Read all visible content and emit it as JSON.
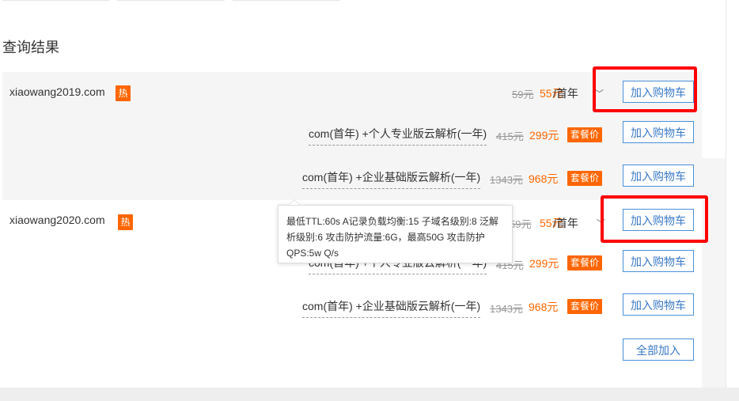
{
  "section_title": "查询结果",
  "domains": [
    {
      "name": "xiaowang2019.com",
      "hot_badge": "热",
      "old_price": "59元",
      "new_price": "55元",
      "unit": "/首年",
      "add_cart": "加入购物车",
      "bundles": [
        {
          "label": "com(首年) +个人专业版云解析(一年)",
          "old_price": "415元",
          "new_price": "299元",
          "deal": "套餐价",
          "add_cart": "加入购物车"
        },
        {
          "label": "com(首年) +企业基础版云解析(一年)",
          "old_price": "1343元",
          "new_price": "968元",
          "deal": "套餐价",
          "add_cart": "加入购物车"
        }
      ]
    },
    {
      "name": "xiaowang2020.com",
      "hot_badge": "热",
      "old_price": "59元",
      "new_price": "55元",
      "unit": "/首年",
      "add_cart": "加入购物车",
      "bundles": [
        {
          "label": "com(首年) +个人专业版云解析(一年)",
          "old_price": "415元",
          "new_price": "299元",
          "deal": "套餐价",
          "add_cart": "加入购物车"
        },
        {
          "label": "com(首年) +企业基础版云解析(一年)",
          "old_price": "1343元",
          "new_price": "968元",
          "deal": "套餐价",
          "add_cart": "加入购物车"
        }
      ]
    }
  ],
  "tooltip": {
    "line1": "最低TTL:60s A记录负载均衡:15 子域名级别:8 泛解",
    "line2": "析级别:6 攻击防护流量:6G，最高50G 攻击防护",
    "line3": "QPS:5w Q/s"
  },
  "add_all": "全部加入",
  "colors": {
    "accent": "#ff6600",
    "link": "#3979c7",
    "highlight": "#ff0000"
  }
}
